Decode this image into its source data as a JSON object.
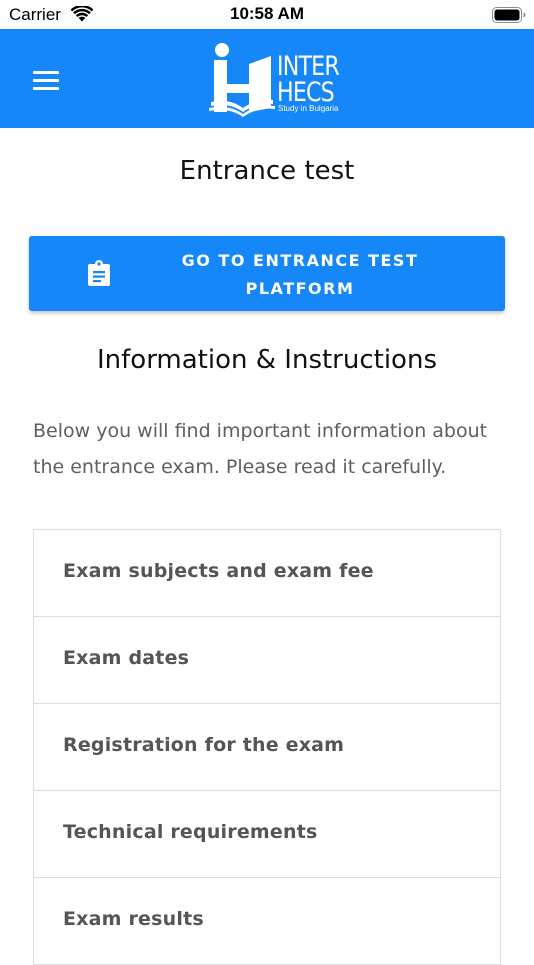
{
  "status_bar": {
    "carrier": "Carrier",
    "time": "10:58 AM",
    "wifi_icon": "wifi-icon",
    "battery_icon": "battery-icon"
  },
  "header": {
    "background_color": "#1587f9",
    "menu_icon": "hamburger-menu-icon",
    "logo": {
      "line1": "INTER",
      "line2": "HECS",
      "tagline": "Study in Bulgaria"
    }
  },
  "main": {
    "title": "Entrance test",
    "cta_button": {
      "icon": "clipboard-icon",
      "label": "GO TO ENTRANCE TEST PLATFORM"
    },
    "section_heading": "Information & Instructions",
    "intro": "Below you will find important information about the entrance exam. Please read it carefully.",
    "accordion": [
      {
        "label": "Exam subjects and exam fee"
      },
      {
        "label": "Exam dates"
      },
      {
        "label": "Registration for the exam"
      },
      {
        "label": "Technical requirements"
      },
      {
        "label": "Exam results"
      }
    ]
  }
}
